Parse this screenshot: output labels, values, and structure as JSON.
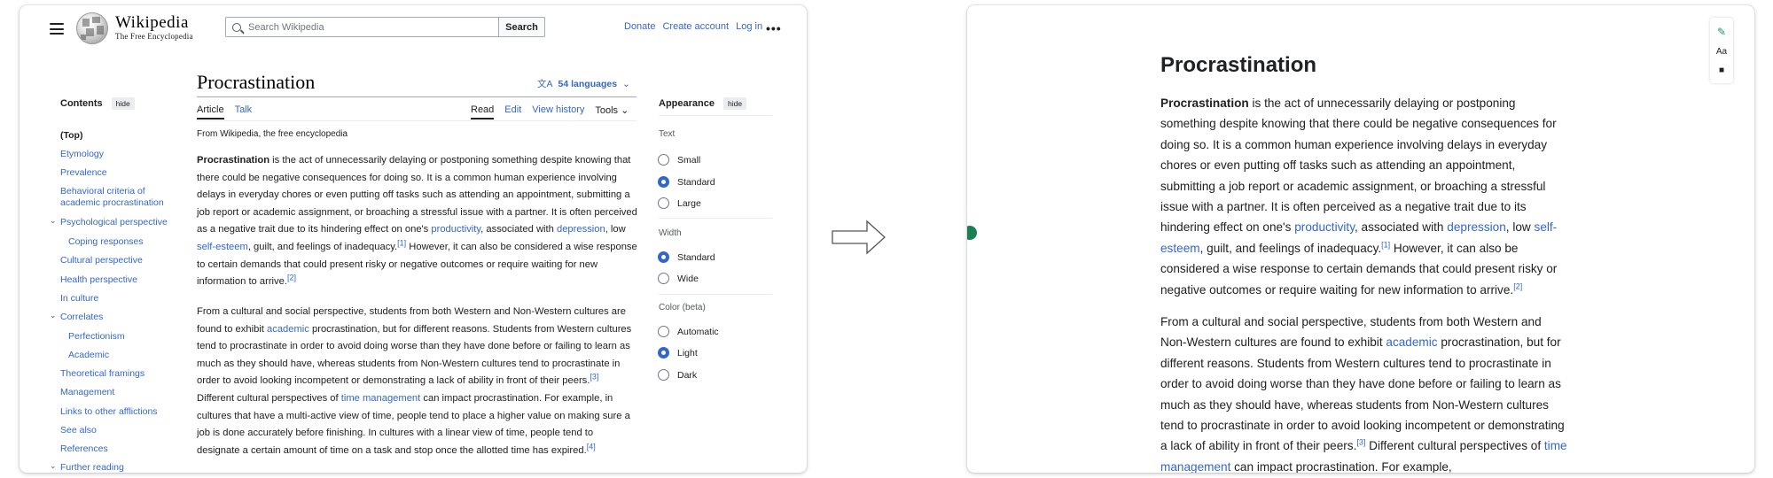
{
  "left": {
    "header": {
      "wordmark": "Wikipedia",
      "tagline": "The Free Encyclopedia",
      "search_placeholder": "Search Wikipedia",
      "search_button": "Search",
      "links": [
        "Donate",
        "Create account",
        "Log in"
      ],
      "more": "•••"
    },
    "toc": {
      "heading": "Contents",
      "hide": "hide",
      "items": [
        {
          "label": "(Top)"
        },
        {
          "label": "Etymology"
        },
        {
          "label": "Prevalence"
        },
        {
          "label": "Behavioral criteria of academic procrastination"
        },
        {
          "label": "Psychological perspective"
        },
        {
          "label": "Coping responses"
        },
        {
          "label": "Cultural perspective"
        },
        {
          "label": "Health perspective"
        },
        {
          "label": "In culture"
        },
        {
          "label": "Correlates"
        },
        {
          "label": "Perfectionism"
        },
        {
          "label": "Academic"
        },
        {
          "label": "Theoretical framings"
        },
        {
          "label": "Management"
        },
        {
          "label": "Links to other afflictions"
        },
        {
          "label": "See also"
        },
        {
          "label": "References"
        },
        {
          "label": "Further reading"
        }
      ]
    },
    "article": {
      "title": "Procrastination",
      "languages": "54 languages",
      "tabs_left": [
        "Article",
        "Talk"
      ],
      "tabs_right": [
        "Read",
        "Edit",
        "View history",
        "Tools"
      ],
      "from": "From Wikipedia, the free encyclopedia",
      "p1": {
        "bold": "Procrastination",
        "t1": " is the act of unnecessarily delaying or postponing something despite knowing that there could be negative consequences for doing so. It is a common human experience involving delays in everyday chores or even putting off tasks such as attending an appointment, submitting a job report or academic assignment, or broaching a stressful issue with a partner. It is often perceived as a negative trait due to its hindering effect on one's ",
        "link1": "productivity",
        "t2": ", associated with ",
        "link2": "depression",
        "t3": ", low ",
        "link3": "self-esteem",
        "t4": ", guilt, and feelings of inadequacy.",
        "ref1": "[1]",
        "t5": " However, it can also be considered a wise response to certain demands that could present risky or negative outcomes or require waiting for new information to arrive.",
        "ref2": "[2]"
      },
      "p2": {
        "t1": "From a cultural and social perspective, students from both Western and Non-Western cultures are found to exhibit ",
        "link1": "academic",
        "t2": " procrastination, but for different reasons. Students from Western cultures tend to procrastinate in order to avoid doing worse than they have done before or failing to learn as much as they should have, whereas students from Non-Western cultures tend to procrastinate in order to avoid looking incompetent or demonstrating a lack of ability in front of their peers.",
        "ref3": "[3]",
        "t3": " Different cultural perspectives of ",
        "link2": "time management",
        "t4": " can impact procrastination. For example, in cultures that have a multi-active view of time, people tend to place a higher value on making sure a job is done accurately before finishing. In cultures with a linear view of time, people tend to designate a certain amount of time on a task and stop once the allotted time has expired.",
        "ref4": "[4]"
      }
    },
    "appearance": {
      "heading": "Appearance",
      "hide": "hide",
      "text_label": "Text",
      "text_options": [
        "Small",
        "Standard",
        "Large"
      ],
      "text_selected": "Standard",
      "width_label": "Width",
      "width_options": [
        "Standard",
        "Wide"
      ],
      "width_selected": "Standard",
      "color_label": "Color (beta)",
      "color_options": [
        "Automatic",
        "Light",
        "Dark"
      ],
      "color_selected": "Light"
    }
  },
  "right": {
    "title": "Procrastination",
    "p1": {
      "bold": "Procrastination",
      "t1": " is the act of unnecessarily delaying or postponing something despite knowing that there could be negative consequences for doing so. It is a common human experience involving delays in everyday chores or even putting off tasks such as attending an appointment, submitting a job report or academic assignment, or broaching a stressful issue with a partner. It is often perceived as a negative trait due to its hindering effect on one's ",
      "link1": "productivity",
      "t2": ", associated with ",
      "link2": "depression",
      "t3": ", low ",
      "link3": "self-esteem",
      "t4": ", guilt, and feelings of inadequacy.",
      "ref1": "[1]",
      "t5": " However, it can also be considered a wise response to certain demands that could present risky or negative outcomes or require waiting for new information to arrive.",
      "ref2": "[2]"
    },
    "p2": {
      "t1": "From a cultural and social perspective, students from both Western and Non-Western cultures are found to exhibit ",
      "link1": "academic",
      "t2": " procrastination, but for different reasons. Students from Western cultures tend to procrastinate in order to avoid doing worse than they have done before or failing to learn as much as they should have, whereas students from Non-Western cultures tend to procrastinate in order to avoid looking incompetent or demonstrating a lack of ability in front of their peers.",
      "ref3": "[3]",
      "t3": " Different cultural perspectives of ",
      "link2": "time management",
      "t4": " can impact procrastination. For example,"
    },
    "tools": {
      "pen_icon": "✎",
      "text_size_icon": "Aa",
      "brush_icon": "🖌"
    }
  },
  "colors": {
    "link": "#3366cc",
    "accent_green": "#1a9a5a"
  }
}
